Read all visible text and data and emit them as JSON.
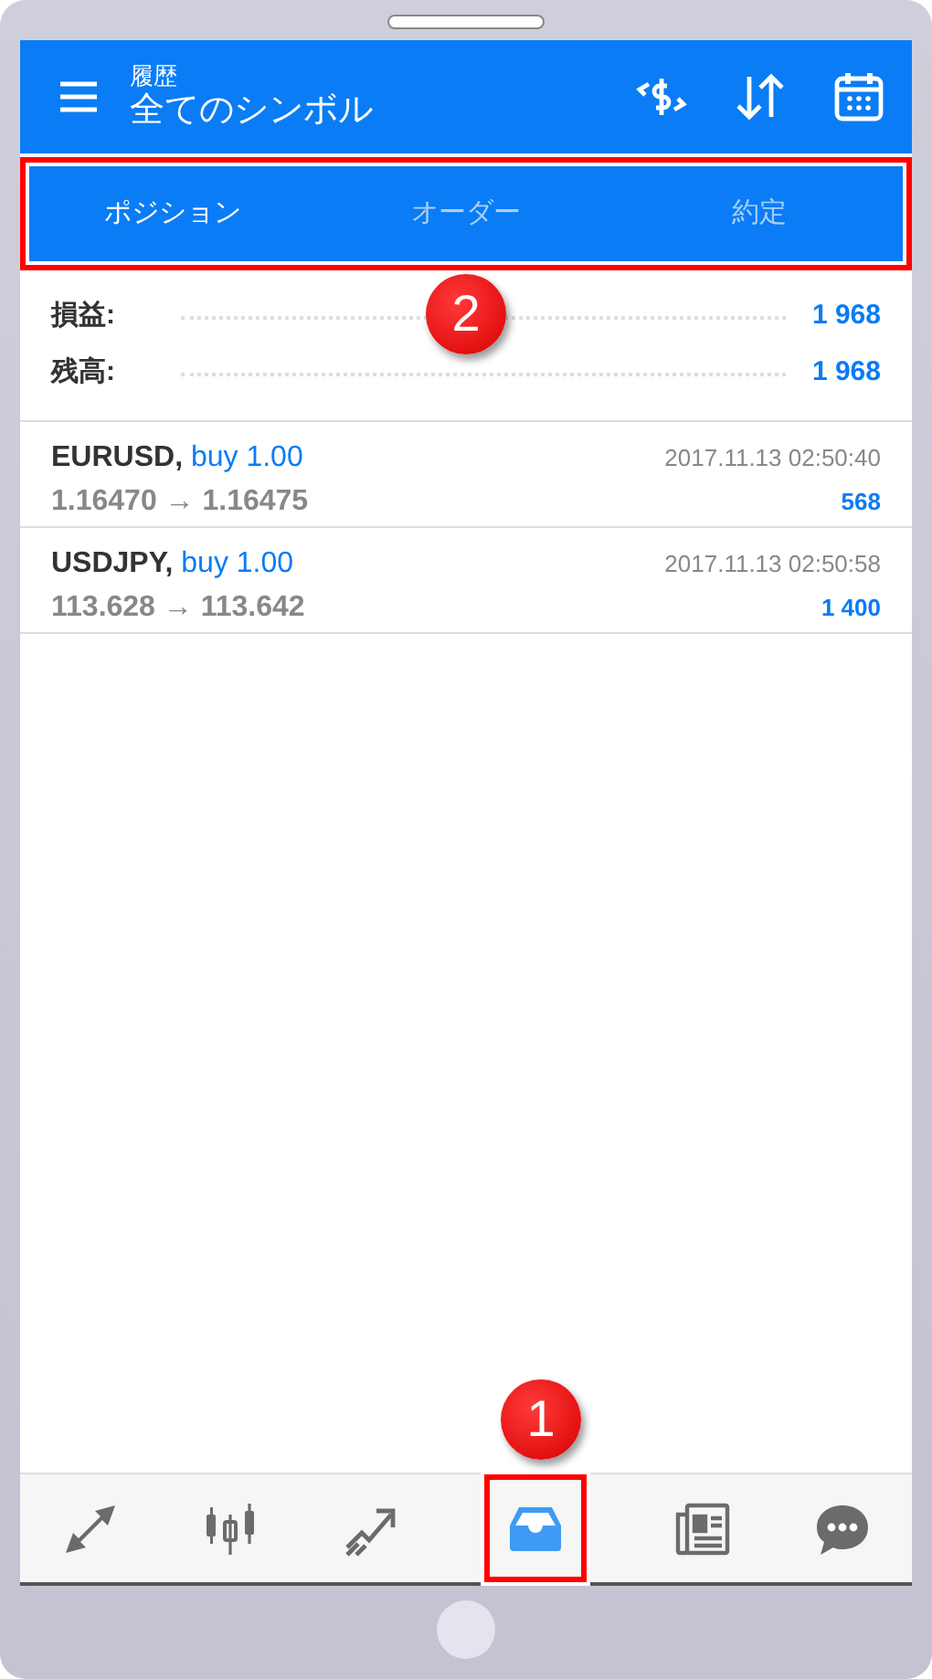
{
  "header": {
    "subtitle": "履歴",
    "title": "全てのシンボル"
  },
  "tabs_highlighted": true,
  "tabs": [
    {
      "label": "ポジション",
      "selected": true
    },
    {
      "label": "オーダー",
      "selected": false
    },
    {
      "label": "約定",
      "selected": false
    }
  ],
  "summary": [
    {
      "label": "損益:",
      "value": "1 968"
    },
    {
      "label": "残高:",
      "value": "1 968"
    }
  ],
  "trades": [
    {
      "symbol": "EURUSD,",
      "side": "buy 1.00",
      "time": "2017.11.13 02:50:40",
      "prices": "1.16470 → 1.16475",
      "profit": "568"
    },
    {
      "symbol": "USDJPY,",
      "side": "buy 1.00",
      "time": "2017.11.13 02:50:58",
      "prices": "113.628 → 113.642",
      "profit": "1 400"
    }
  ],
  "nav": [
    {
      "kind": "quotes",
      "selected": false,
      "highlighted": false
    },
    {
      "kind": "chart",
      "selected": false,
      "highlighted": false
    },
    {
      "kind": "trade",
      "selected": false,
      "highlighted": false
    },
    {
      "kind": "history",
      "selected": true,
      "highlighted": true
    },
    {
      "kind": "news",
      "selected": false,
      "highlighted": false
    },
    {
      "kind": "chat",
      "selected": false,
      "highlighted": false
    }
  ],
  "callouts": [
    {
      "label": "1",
      "kind": "nav"
    },
    {
      "label": "2",
      "kind": "tabs"
    }
  ]
}
